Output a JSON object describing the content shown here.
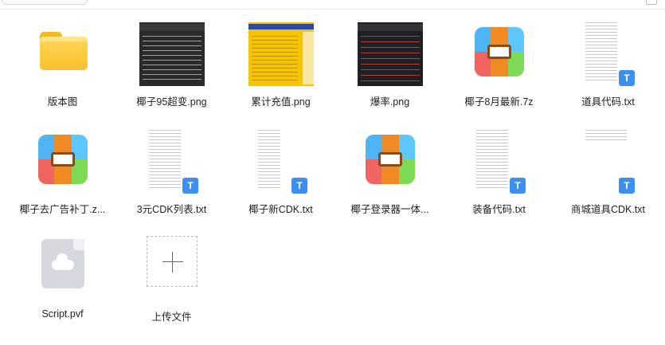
{
  "files": [
    {
      "kind": "folder",
      "name": "版本图",
      "icon": "folder-icon"
    },
    {
      "kind": "image",
      "name": "椰子95超变.png",
      "icon": "image-thumbnail-icon",
      "theme": "dark"
    },
    {
      "kind": "image",
      "name": "累计充值.png",
      "icon": "image-thumbnail-icon",
      "theme": "yellow"
    },
    {
      "kind": "image",
      "name": "爆率.png",
      "icon": "image-thumbnail-icon",
      "theme": "dark2"
    },
    {
      "kind": "archive",
      "name": "椰子8月最新.7z",
      "icon": "archive-icon"
    },
    {
      "kind": "text",
      "name": "道具代码.txt",
      "icon": "text-file-icon",
      "badge": "T"
    },
    {
      "kind": "archive",
      "name": "椰子去广告补丁.z...",
      "icon": "archive-icon"
    },
    {
      "kind": "text",
      "name": "3元CDK列表.txt",
      "icon": "text-file-icon",
      "badge": "T"
    },
    {
      "kind": "text",
      "name": "椰子新CDK.txt",
      "icon": "text-file-icon",
      "badge": "T"
    },
    {
      "kind": "archive",
      "name": "椰子登录器一体...",
      "icon": "archive-icon"
    },
    {
      "kind": "text",
      "name": "装备代码.txt",
      "icon": "text-file-icon",
      "badge": "T"
    },
    {
      "kind": "text",
      "name": "商城道具CDK.txt",
      "icon": "text-file-icon",
      "badge": "T"
    },
    {
      "kind": "pvf",
      "name": "Script.pvf",
      "icon": "cloud-file-icon"
    },
    {
      "kind": "upload",
      "name": "上传文件",
      "icon": "plus-icon"
    }
  ]
}
